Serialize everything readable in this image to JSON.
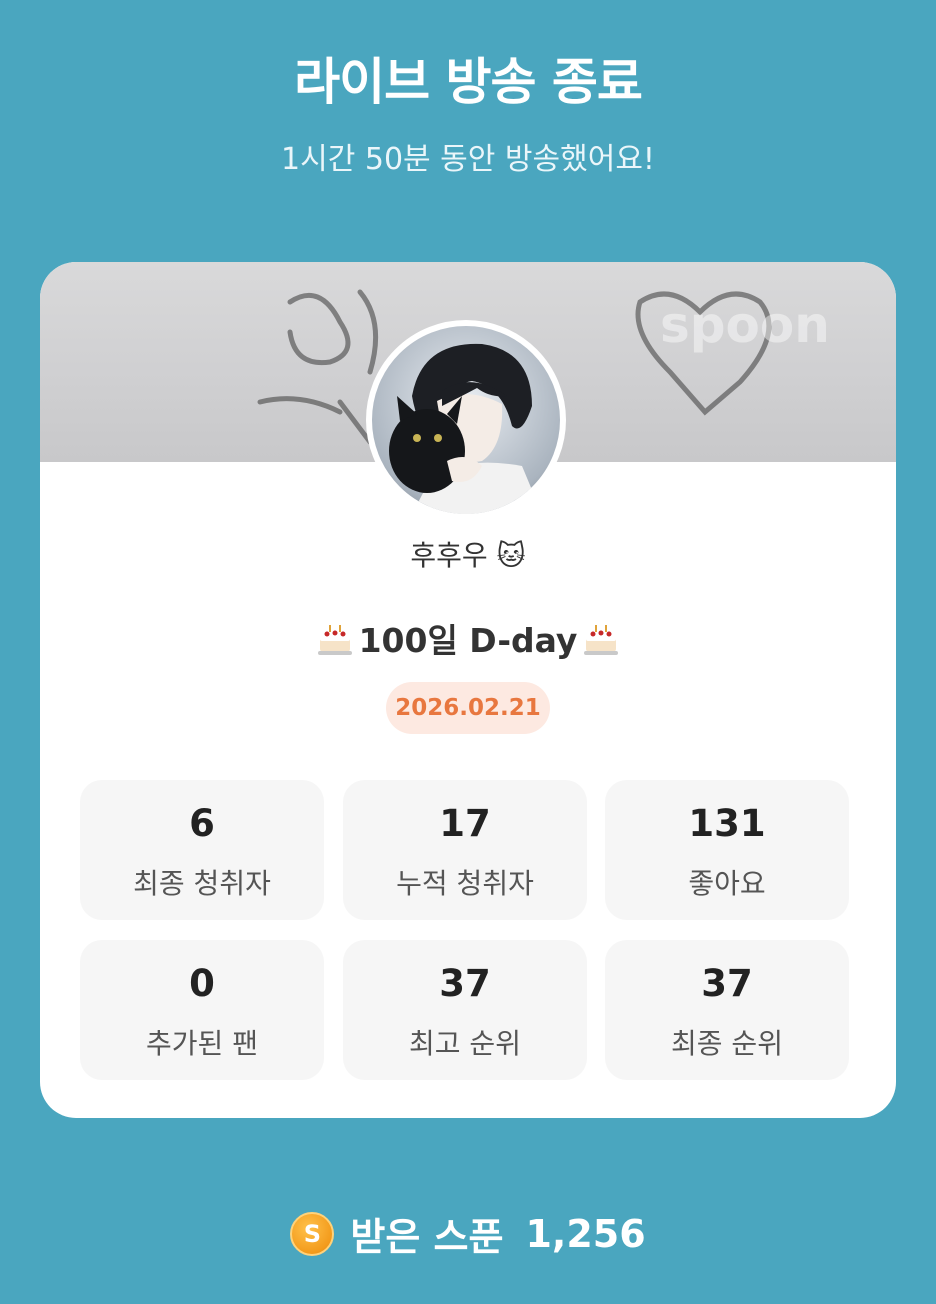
{
  "header": {
    "title": "라이브 방송 종료",
    "subtitle": "1시간 50분 동안 방송했어요!"
  },
  "card": {
    "banner_watermark": "spoon",
    "username": "후후우 🐱",
    "event_title": "100일 D-day",
    "event_icon": "cake-icon",
    "date": "2026.02.21",
    "stats": [
      {
        "value": "6",
        "label": "최종 청취자"
      },
      {
        "value": "17",
        "label": "누적 청취자"
      },
      {
        "value": "131",
        "label": "좋아요"
      },
      {
        "value": "0",
        "label": "추가된 팬"
      },
      {
        "value": "37",
        "label": "최고 순위"
      },
      {
        "value": "37",
        "label": "최종 순위"
      }
    ]
  },
  "footer": {
    "coin_letter": "S",
    "spoons_label": "받은 스푼",
    "spoons_value": "1,256"
  },
  "colors": {
    "background": "#4aa6bf",
    "card": "#ffffff",
    "date_pill_bg": "#fde9e1",
    "date_pill_text": "#e8773f",
    "stat_bg": "#f6f6f6"
  }
}
